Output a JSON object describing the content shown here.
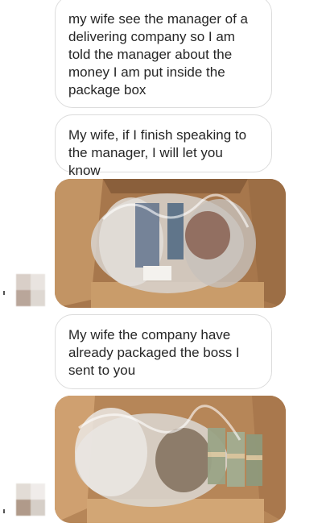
{
  "conversation": {
    "messages": [
      {
        "type": "text",
        "text": "my wife see the manager of a delivering company so I am told the manager about the money I am put inside the package box"
      },
      {
        "type": "text",
        "text": "My wife, if I finish speaking to the manager, I will let you know"
      },
      {
        "type": "image",
        "alt_icon": "package-box-photo"
      },
      {
        "type": "text",
        "text": "My wife the company have already packaged the boss I sent to you"
      },
      {
        "type": "image",
        "alt_icon": "package-box-with-money-photo"
      }
    ]
  },
  "colors": {
    "bubble_border": "#dcdcdc",
    "bubble_text": "#262626",
    "background": "#ffffff"
  }
}
